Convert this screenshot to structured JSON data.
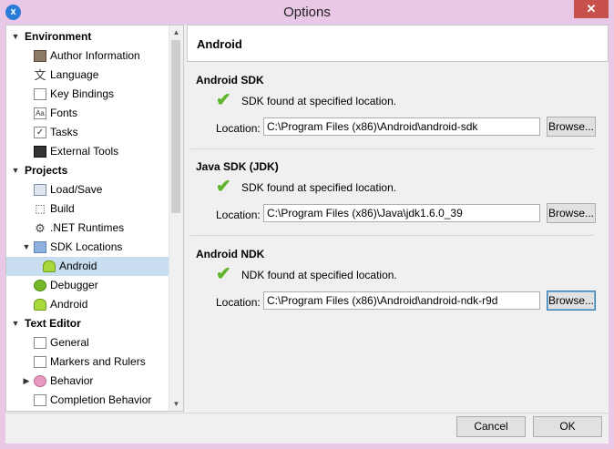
{
  "window": {
    "title": "Options",
    "close_glyph": "✕",
    "app_glyph": "x"
  },
  "tree": {
    "items": [
      {
        "label": "Environment",
        "level": 0,
        "expanded": true,
        "category": true
      },
      {
        "label": "Author Information",
        "level": 1,
        "icon": "person-icon"
      },
      {
        "label": "Language",
        "level": 1,
        "icon": "language-icon"
      },
      {
        "label": "Key Bindings",
        "level": 1,
        "icon": "key-bindings-icon"
      },
      {
        "label": "Fonts",
        "level": 1,
        "icon": "fonts-icon"
      },
      {
        "label": "Tasks",
        "level": 1,
        "icon": "tasks-icon"
      },
      {
        "label": "External Tools",
        "level": 1,
        "icon": "external-tools-icon"
      },
      {
        "label": "Projects",
        "level": 0,
        "expanded": true,
        "category": true
      },
      {
        "label": "Load/Save",
        "level": 1,
        "icon": "load-save-icon"
      },
      {
        "label": "Build",
        "level": 1,
        "icon": "build-icon"
      },
      {
        "label": ".NET Runtimes",
        "level": 1,
        "icon": "gear-icon"
      },
      {
        "label": "SDK Locations",
        "level": 1,
        "expanded": true,
        "icon": "folder-icon"
      },
      {
        "label": "Android",
        "level": 2,
        "selected": true,
        "icon": "android-icon"
      },
      {
        "label": "Debugger",
        "level": 1,
        "icon": "debugger-icon"
      },
      {
        "label": "Android",
        "level": 1,
        "icon": "android-icon"
      },
      {
        "label": "Text Editor",
        "level": 0,
        "expanded": true,
        "category": true
      },
      {
        "label": "General",
        "level": 1,
        "icon": "general-icon"
      },
      {
        "label": "Markers and Rulers",
        "level": 1,
        "icon": "markers-icon"
      },
      {
        "label": "Behavior",
        "level": 1,
        "expanded": false,
        "icon": "behavior-icon"
      },
      {
        "label": "Completion Behavior",
        "level": 1,
        "icon": "completion-icon"
      }
    ]
  },
  "panel": {
    "title": "Android",
    "location_label": "Location:",
    "browse_label": "Browse...",
    "sections": [
      {
        "title": "Android SDK",
        "status": "SDK found at specified location.",
        "location": "C:\\Program Files (x86)\\Android\\android-sdk"
      },
      {
        "title": "Java SDK (JDK)",
        "status": "SDK found at specified location.",
        "location": "C:\\Program Files (x86)\\Java\\jdk1.6.0_39"
      },
      {
        "title": "Android NDK",
        "status": "NDK found at specified location.",
        "location": "C:\\Program Files (x86)\\Android\\android-ndk-r9d"
      }
    ]
  },
  "buttons": {
    "cancel": "Cancel",
    "ok": "OK"
  },
  "colors": {
    "accent": "#c9ddf0",
    "check": "#5fb42c",
    "close": "#c7504c",
    "frame": "#e9c7e6"
  }
}
